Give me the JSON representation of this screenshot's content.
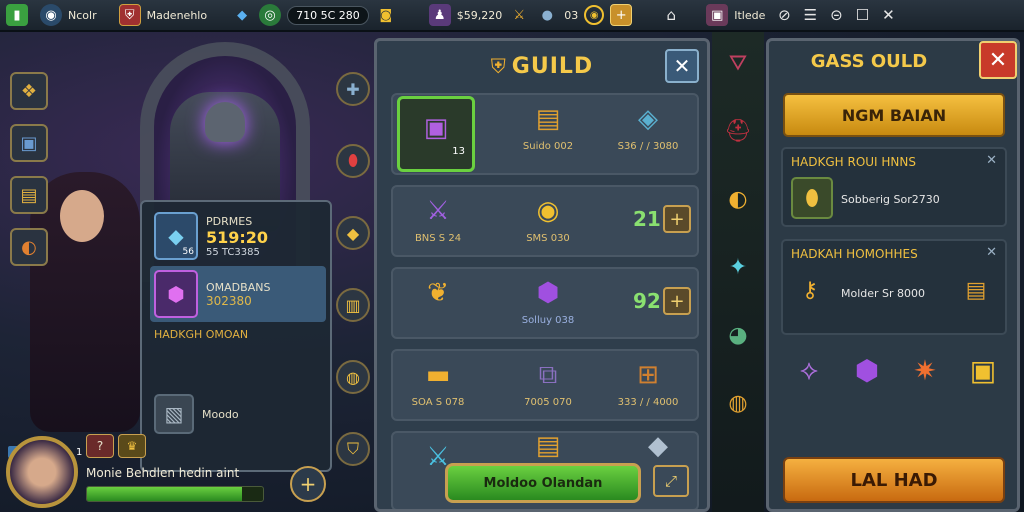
{
  "topbar": {
    "app_name": "Ncolr",
    "player_name": "Madenehlo",
    "stat_a": "710 5C 280",
    "stat_b": "$59,220",
    "stat_c": "03",
    "right_label": "Itlede"
  },
  "scene_popup": {
    "row1_label": "PDRMES",
    "row1_value": "519:20",
    "row1_sub": "55 TC3385",
    "row1_badge": "56",
    "row2_label": "OMADBANS",
    "row2_value": "302380",
    "section_label": "HADKGH OMOAN",
    "row3_label": "Moodo"
  },
  "player": {
    "level_badge": "1 956",
    "name": "Monie  Behdlen hedin aint",
    "xp_progress": 0.88
  },
  "guild": {
    "title": "GUILD",
    "rows": [
      {
        "cells": [
          {
            "label": "",
            "badge": "13"
          },
          {
            "label": "Suido 002"
          },
          {
            "label": "S36 / / 3080"
          }
        ]
      },
      {
        "cells": [
          {
            "label": "BNS S 24"
          },
          {
            "label": "SMS 030"
          }
        ],
        "qty": "21"
      },
      {
        "cells": [
          {
            "label": ""
          },
          {
            "label": "Solluy 038"
          }
        ],
        "qty": "92"
      },
      {
        "cells": [
          {
            "label": "SOA S 078"
          },
          {
            "label": "7005 070"
          },
          {
            "label": "333 / / 4000"
          }
        ]
      },
      {
        "cells": [
          {
            "label": ""
          },
          {
            "label": ""
          },
          {
            "label": ""
          }
        ]
      }
    ],
    "action_label": "Moldoo Olandan"
  },
  "rpanel": {
    "title": "GASS OULD",
    "top_button": "NGM BAIAN",
    "card1": {
      "title": "HADKGH ROUI HNNS",
      "text": "Sobberig Sor2730"
    },
    "card2": {
      "title": "HADKAH HOMOHHES",
      "text": "Molder Sr 8000"
    },
    "bottom_button": "LAL HAD"
  }
}
